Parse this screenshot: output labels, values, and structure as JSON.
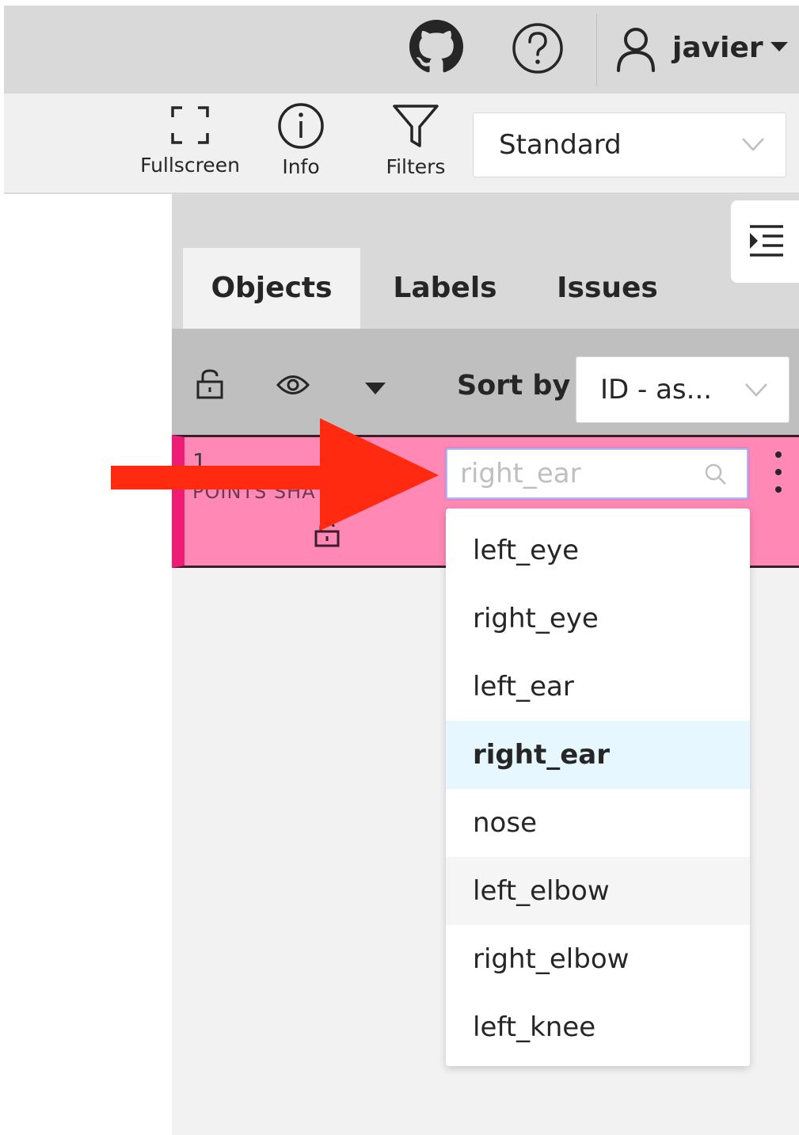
{
  "header": {
    "user_name": "javier",
    "icons": [
      "github-icon",
      "help-icon",
      "user-icon",
      "caret-down-icon"
    ]
  },
  "toolbar": {
    "fullscreen_label": "Fullscreen",
    "info_label": "Info",
    "filters_label": "Filters",
    "workspace_mode": "Standard"
  },
  "sidebar": {
    "tabs": [
      {
        "label": "Objects",
        "active": true
      },
      {
        "label": "Labels",
        "active": false
      },
      {
        "label": "Issues",
        "active": false
      }
    ],
    "sort_label": "Sort by",
    "sort_value": "ID - as..."
  },
  "object": {
    "id": "1",
    "type": "POINTS SHA",
    "color": "#ff88b5",
    "accent_color": "#ef1c76",
    "label_placeholder": "right_ear"
  },
  "label_dropdown": {
    "options": [
      {
        "label": "left_eye"
      },
      {
        "label": "right_eye"
      },
      {
        "label": "left_ear"
      },
      {
        "label": "right_ear",
        "selected": true
      },
      {
        "label": "nose"
      },
      {
        "label": "left_elbow",
        "hover": true
      },
      {
        "label": "right_elbow"
      },
      {
        "label": "left_knee"
      }
    ]
  },
  "annotation": {
    "arrow_color": "#ff2a0f"
  }
}
